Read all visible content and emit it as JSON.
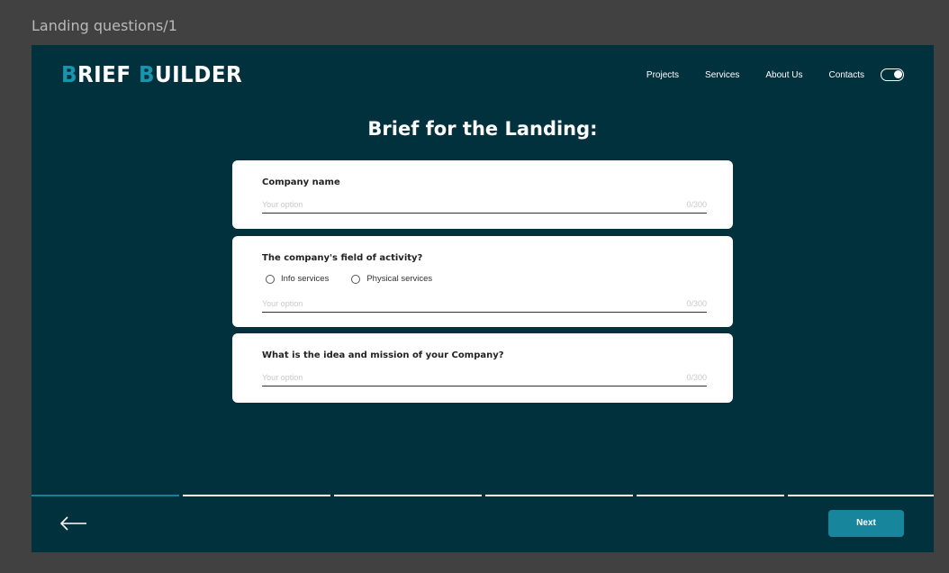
{
  "frame": {
    "label": "Landing questions/1"
  },
  "header": {
    "logo": {
      "first_initial": "B",
      "first_rest": "RIEF",
      "second_initial": "B",
      "second_rest": "UILDER"
    },
    "nav": [
      "Projects",
      "Services",
      "About Us",
      "Contacts"
    ]
  },
  "page": {
    "title": "Brief for the Landing:"
  },
  "questions": [
    {
      "label": "Company name",
      "placeholder": "Your option",
      "counter": "0/300"
    },
    {
      "label": "The company's field of activity?",
      "options": [
        "Info services",
        "Physical services"
      ],
      "placeholder": "Your option",
      "counter": "0/300"
    },
    {
      "label": "What is the idea and mission of your Company?",
      "placeholder": "Your option",
      "counter": "0/300"
    }
  ],
  "progress": {
    "current_step": 1,
    "total_steps": 6
  },
  "footer": {
    "next_label": "Next"
  },
  "colors": {
    "background": "#02313e",
    "accent": "#17869c",
    "logo_accent": "#1a93ad"
  }
}
